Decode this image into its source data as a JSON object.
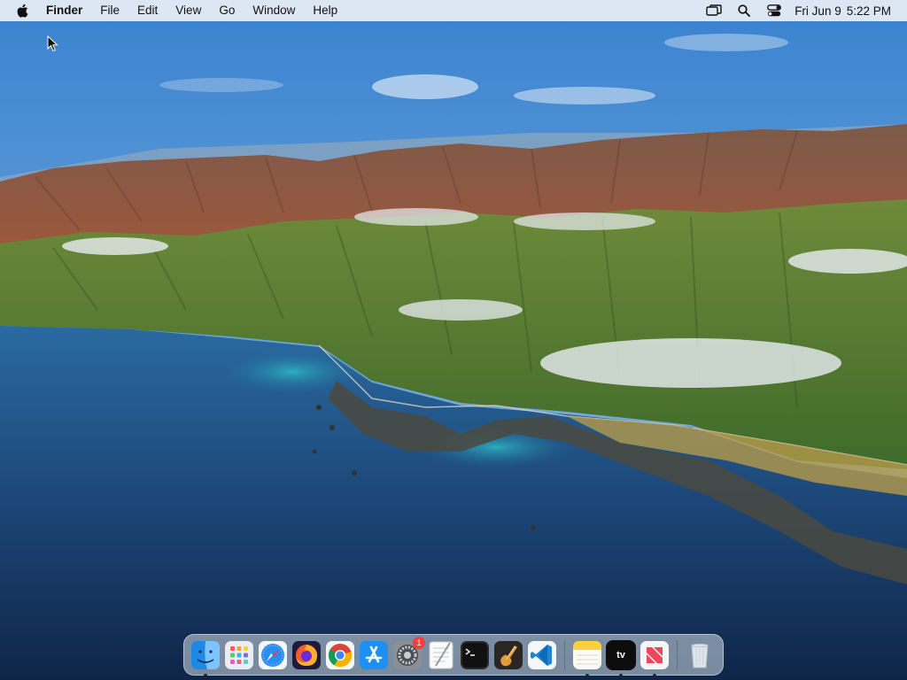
{
  "menubar": {
    "app_name": "Finder",
    "menus": [
      "File",
      "Edit",
      "View",
      "Go",
      "Window",
      "Help"
    ],
    "status_icons": [
      "screen-mirroring-icon",
      "spotlight-search-icon",
      "control-center-icon"
    ],
    "clock": {
      "date": "Fri Jun 9",
      "time": "5:22 PM"
    }
  },
  "desktop": {
    "wallpaper": "Big Sur coastline"
  },
  "dock": {
    "apps": [
      {
        "name": "Finder",
        "icon": "finder-icon",
        "running": true
      },
      {
        "name": "Launchpad",
        "icon": "launchpad-icon",
        "running": false
      },
      {
        "name": "Safari",
        "icon": "safari-icon",
        "running": false
      },
      {
        "name": "Firefox",
        "icon": "firefox-icon",
        "running": false
      },
      {
        "name": "Chrome",
        "icon": "chrome-icon",
        "running": false
      },
      {
        "name": "App Store",
        "icon": "app-store-icon",
        "running": false
      },
      {
        "name": "System Preferences",
        "icon": "system-preferences-icon",
        "running": false,
        "badge": "1"
      },
      {
        "name": "TextEdit",
        "icon": "textedit-icon",
        "running": false
      },
      {
        "name": "Terminal",
        "icon": "terminal-icon",
        "running": false
      },
      {
        "name": "GarageBand",
        "icon": "garageband-icon",
        "running": false
      },
      {
        "name": "Visual Studio Code",
        "icon": "vscode-icon",
        "running": false
      }
    ],
    "recent_apps": [
      {
        "name": "Notes",
        "icon": "notes-icon",
        "running": true
      },
      {
        "name": "TV",
        "icon": "apple-tv-icon",
        "running": true,
        "label": "tv"
      },
      {
        "name": "News",
        "icon": "news-icon",
        "running": true
      }
    ],
    "trash": {
      "name": "Trash",
      "icon": "trash-icon"
    }
  },
  "colors": {
    "menubar_bg": "#ECF0F6",
    "badge": "#F0413A",
    "sky_top": "#3E86D2",
    "ocean": "#1B3F6E"
  }
}
